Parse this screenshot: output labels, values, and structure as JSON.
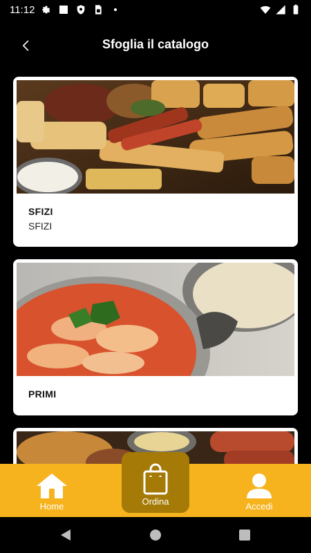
{
  "status_bar": {
    "time": "11:12",
    "icons": [
      "settings-icon",
      "square-icon",
      "shield-icon",
      "sim-card-icon",
      "dot-icon",
      "wifi-icon",
      "signal-icon",
      "battery-icon"
    ]
  },
  "header": {
    "title": "Sfoglia il catalogo",
    "back_icon": "chevron-left-icon"
  },
  "catalog": {
    "cards": [
      {
        "title": "SFIZI",
        "subtitle": "SFIZI",
        "image": "fried-appetizers-photo"
      },
      {
        "title": "PRIMI",
        "subtitle": "",
        "image": "gnocchi-pasta-photo"
      },
      {
        "title": "",
        "subtitle": "",
        "image": "grilled-meat-platter-photo"
      }
    ]
  },
  "bottom_nav": {
    "items": [
      {
        "label": "Home",
        "icon": "home-icon"
      },
      {
        "label": "Ordina",
        "icon": "shopping-bag-icon"
      },
      {
        "label": "Accedi",
        "icon": "user-icon"
      }
    ],
    "colors": {
      "bar": "#f6b31d",
      "active": "#a57a06",
      "label": "#ffffff"
    }
  },
  "system_nav": {
    "icons": [
      "back-triangle-icon",
      "home-circle-icon",
      "recents-square-icon"
    ]
  }
}
